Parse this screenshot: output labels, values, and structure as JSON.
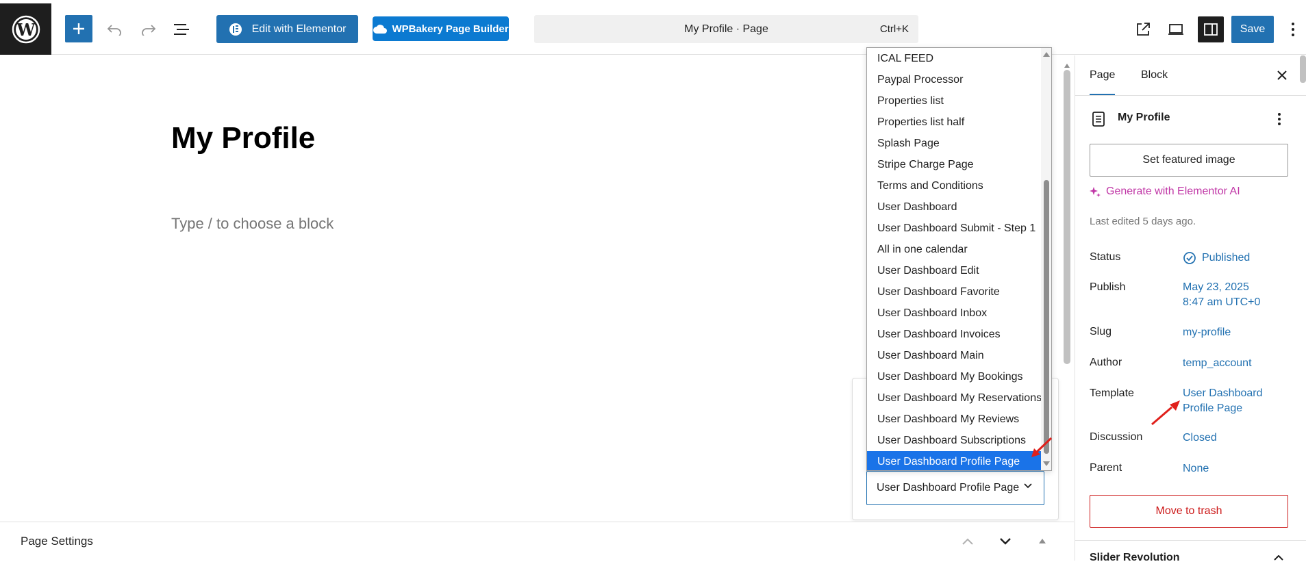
{
  "toolbar": {
    "elementor_label": "Edit with Elementor",
    "wpbakery_label": "WPBakery Page Builder",
    "command_title": "My Profile · Page",
    "command_shortcut": "Ctrl+K",
    "save_label": "Save"
  },
  "editor": {
    "title": "My Profile",
    "placeholder": "Type / to choose a block"
  },
  "dropdown": {
    "items": [
      "ICAL FEED",
      "Paypal Processor",
      "Properties list",
      "Properties list half",
      "Splash Page",
      "Stripe Charge Page",
      "Terms and Conditions",
      "User Dashboard",
      "User Dashboard Submit - Step 1",
      "All in one calendar",
      "User Dashboard Edit",
      "User Dashboard Favorite",
      "User Dashboard Inbox",
      "User Dashboard Invoices",
      "User Dashboard Main",
      "User Dashboard My Bookings",
      "User Dashboard My Reservations",
      "User Dashboard My Reviews",
      "User Dashboard Subscriptions",
      "User Dashboard Profile Page"
    ],
    "selected": "User Dashboard Profile Page"
  },
  "template_select": {
    "value": "User Dashboard Profile Page"
  },
  "page_settings": {
    "label": "Page Settings"
  },
  "sidebar": {
    "tabs": [
      "Page",
      "Block"
    ],
    "doc_title": "My Profile",
    "featured_image_label": "Set featured image",
    "ai_label": "Generate with Elementor AI",
    "last_edited": "Last edited 5 days ago.",
    "rows": {
      "status": {
        "label": "Status",
        "value": "Published"
      },
      "publish": {
        "label": "Publish",
        "value_line1": "May 23, 2025",
        "value_line2": "8:47 am UTC+0"
      },
      "slug": {
        "label": "Slug",
        "value": "my-profile"
      },
      "author": {
        "label": "Author",
        "value": "temp_account"
      },
      "template": {
        "label": "Template",
        "value_line1": "User Dashboard",
        "value_line2": "Profile Page"
      },
      "discussion": {
        "label": "Discussion",
        "value": "Closed"
      },
      "parent": {
        "label": "Parent",
        "value": "None"
      }
    },
    "trash_label": "Move to trash",
    "next_section": "Slider Revolution"
  },
  "colors": {
    "accent": "#2271b1",
    "selected": "#1a73e8",
    "ai": "#c036a6",
    "danger": "#cc1818",
    "annotation": "#e0201b"
  }
}
